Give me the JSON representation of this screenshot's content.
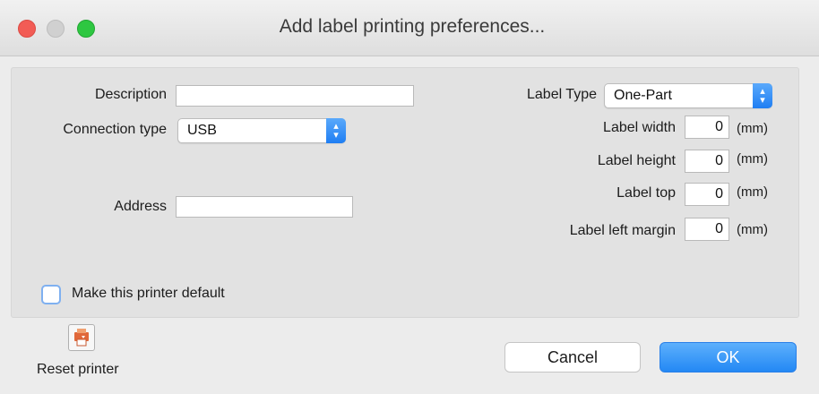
{
  "window": {
    "title": "Add label printing preferences..."
  },
  "left": {
    "description_label": "Description",
    "description_value": "",
    "connection_label": "Connection type",
    "connection_value": "USB",
    "address_label": "Address",
    "address_value": ""
  },
  "right": {
    "label_type_label": "Label Type",
    "label_type_value": "One-Part",
    "fields": [
      {
        "label": "Label width",
        "value": "0",
        "unit": "(mm)"
      },
      {
        "label": "Label height",
        "value": "0",
        "unit": "(mm)"
      },
      {
        "label": "Label top",
        "value": "0",
        "unit": "(mm)"
      },
      {
        "label": "Label left margin",
        "value": "0",
        "unit": "(mm)"
      }
    ]
  },
  "default_checkbox": {
    "label": "Make this printer default",
    "checked": false
  },
  "footer": {
    "reset_label": "Reset printer",
    "cancel_label": "Cancel",
    "ok_label": "OK"
  },
  "colors": {
    "accent": "#2388f4",
    "close": "#f25c55",
    "zoom": "#2ec741"
  },
  "icons": {
    "reset": "printer-reset-icon",
    "popup_arrows": "up-down-chevron-icon"
  }
}
